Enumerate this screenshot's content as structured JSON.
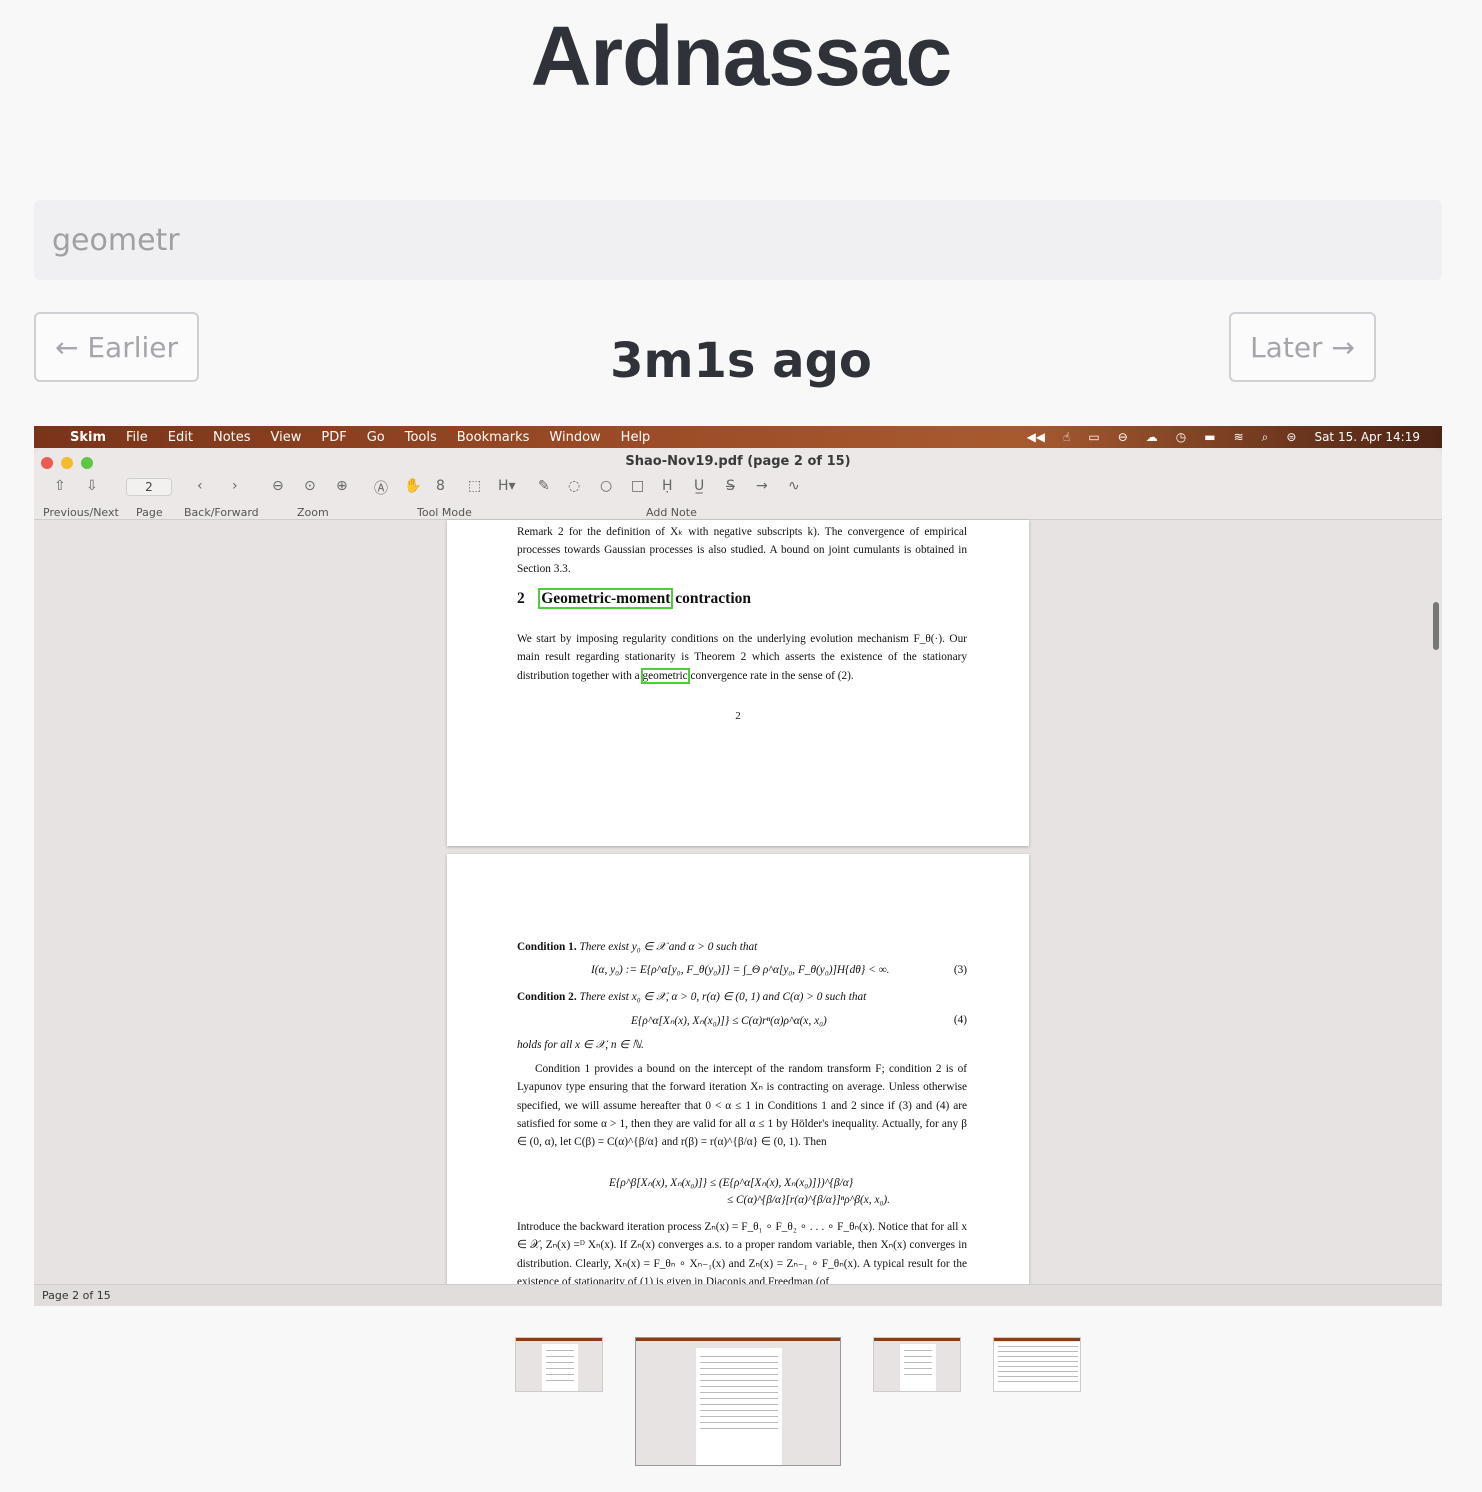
{
  "app": {
    "title": "Ardnassac"
  },
  "search": {
    "placeholder": "geometr"
  },
  "nav": {
    "earlier_label": "← Earlier",
    "later_label": "Later →",
    "timestamp": "3m1s ago"
  },
  "screenshot": {
    "menubar": {
      "app_name": "Skim",
      "items": [
        "File",
        "Edit",
        "Notes",
        "View",
        "PDF",
        "Go",
        "Tools",
        "Bookmarks",
        "Window",
        "Help"
      ],
      "datetime": "Sat 15. Apr  14:19"
    },
    "window_title": "Shao-Nov19.pdf (page 2 of 15)",
    "toolbar": {
      "page_value": "2",
      "labels": {
        "prev_next": "Previous/Next",
        "page": "Page",
        "back_forward": "Back/Forward",
        "zoom": "Zoom",
        "tool_mode": "Tool Mode",
        "add_note": "Add Note"
      }
    },
    "statusbar": "Page 2 of 15",
    "pdf": {
      "page_a": {
        "para1": "Remark 2 for the definition of Xₖ with negative subscripts k). The convergence of empirical processes towards Gaussian processes is also studied. A bound on joint cumulants is obtained in Section 3.3.",
        "section_num": "2",
        "section_highlight": "Geometric-moment",
        "section_rest": "contraction",
        "para2_a": "We start by imposing regularity conditions on the underlying evolution mechanism F_θ(·). Our main result regarding stationarity is Theorem 2 which asserts the existence of the stationary distribution together with a",
        "para2_hl": "geometric",
        "para2_b": "convergence rate in the sense of (2).",
        "page_number": "2"
      },
      "page_b": {
        "cond1_label": "Condition 1.",
        "cond1_text": "There exist y₀ ∈ 𝒳 and α > 0 such that",
        "eq3": "I(α, y₀) := E{ρ^α[y₀, F_θ(y₀)]} = ∫_Θ ρ^α[y₀, F_θ(y₀)]H{dθ} < ∞.",
        "eq3_num": "(3)",
        "cond2_label": "Condition 2.",
        "cond2_text": "There exist x₀ ∈ 𝒳, α > 0, r(α) ∈ (0, 1) and C(α) > 0 such that",
        "eq4": "E{ρ^α[Xₙ(x), Xₙ(x₀)]} ≤ C(α)rⁿ(α)ρ^α(x, x₀)",
        "eq4_num": "(4)",
        "holds": "holds for all x ∈ 𝒳, n ∈ ℕ.",
        "para1": "Condition 1 provides a bound on the intercept of the random transform F; condition 2 is of Lyapunov type ensuring that the forward iteration Xₙ is contracting on average. Unless otherwise specified, we will assume hereafter that 0 < α ≤ 1 in Conditions 1 and 2 since if (3) and (4) are satisfied for some α > 1, then they are valid for all α ≤ 1 by Hölder's inequality. Actually, for any β ∈ (0, α), let C(β) = C(α)^{β/α} and r(β) = r(α)^{β/α} ∈ (0, 1). Then",
        "ineq1": "E{ρ^β[Xₙ(x), Xₙ(x₀)]}  ≤  (E{ρ^α[Xₙ(x), Xₙ(x₀)]})^{β/α}",
        "ineq2": "≤  C(α)^{β/α}[r(α)^{β/α}]ⁿρ^β(x, x₀).",
        "para2": "Introduce the backward iteration process Zₙ(x) = F_θ₁ ∘ F_θ₂ ∘ . . . ∘ F_θₙ(x). Notice that for all x ∈ 𝒳, Zₙ(x) =ᴰ Xₙ(x). If Zₙ(x) converges a.s. to a proper random variable, then Xₙ(x) converges in distribution. Clearly, Xₙ(x) = F_θₙ ∘ Xₙ₋₁(x) and Zₙ(x) = Zₙ₋₁ ∘ F_θₙ(x). A typical result for the existence of stationarity of (1) is given in Diaconis and Freedman (of"
      }
    }
  },
  "thumbnails": [
    {
      "name": "thumb-1",
      "selected": false
    },
    {
      "name": "thumb-2",
      "selected": true
    },
    {
      "name": "thumb-3",
      "selected": false
    },
    {
      "name": "thumb-4",
      "selected": false
    }
  ],
  "colors": {
    "highlight": "#4cd03a",
    "menubar": "#9a4a25",
    "title": "#30323a"
  }
}
